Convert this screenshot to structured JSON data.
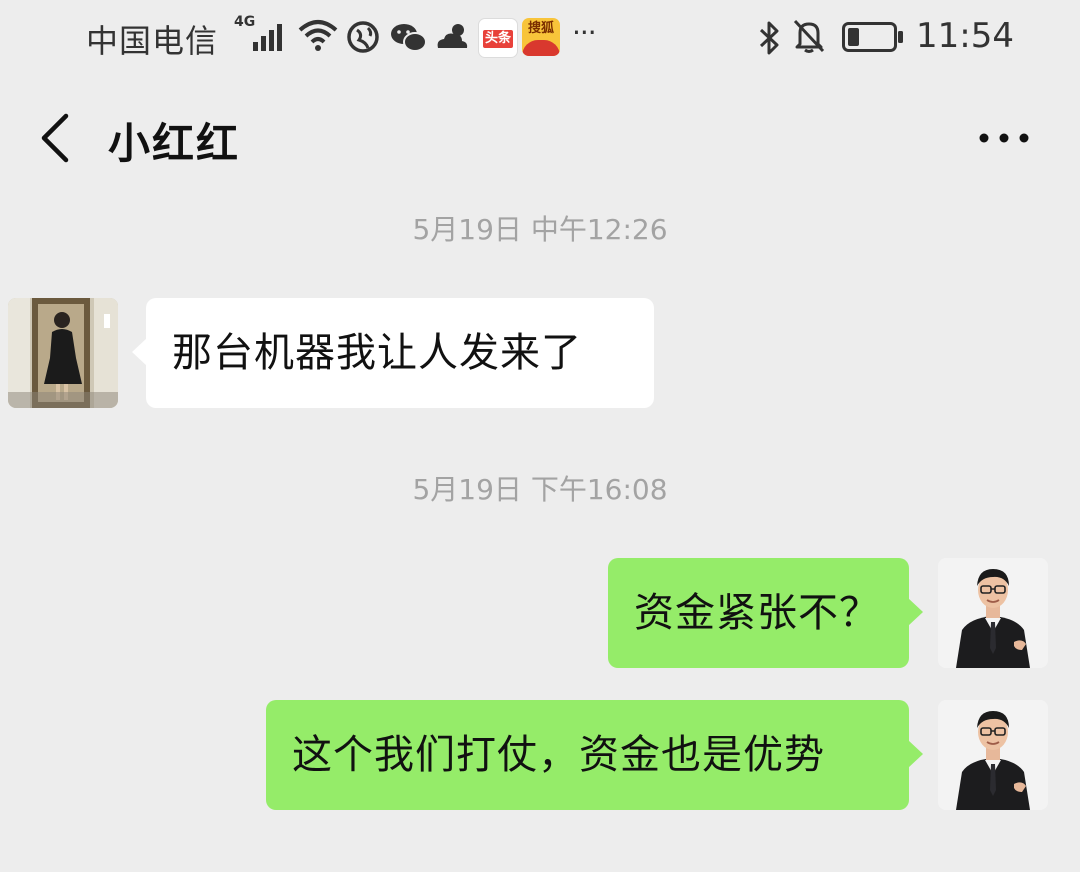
{
  "status_bar": {
    "carrier": "中国电信",
    "network_type": "4G",
    "icons": [
      "signal-icon",
      "wifi-icon",
      "vpn-icon",
      "wechat-icon",
      "weather-icon",
      "toutiao-app-icon",
      "sohu-app-icon",
      "more-notifications-icon",
      "bluetooth-icon",
      "mute-icon",
      "battery-icon"
    ],
    "toutiao_label": "头条",
    "sohu_label": "搜狐",
    "more_notifications": "···",
    "time": "11:54",
    "battery_level": 0.25
  },
  "header": {
    "title": "小红红",
    "back_icon": "chevron-left-icon",
    "more_icon": "more-dots-icon"
  },
  "messages": [
    {
      "type": "timestamp",
      "text": "5月19日 中午12:26"
    },
    {
      "type": "received",
      "avatar": "woman-photo-avatar",
      "text": "那台机器我让人发来了"
    },
    {
      "type": "timestamp",
      "text": "5月19日 下午16:08"
    },
    {
      "type": "sent",
      "avatar": "man-suit-avatar",
      "text": "资金紧张不？"
    },
    {
      "type": "sent",
      "avatar": "man-suit-avatar",
      "text": "这个我们打仗，资金也是优势"
    }
  ],
  "colors": {
    "background": "#EDEDED",
    "sent_bubble": "#95EC69",
    "received_bubble": "#FFFFFF",
    "timestamp_text": "#A3A3A3"
  }
}
